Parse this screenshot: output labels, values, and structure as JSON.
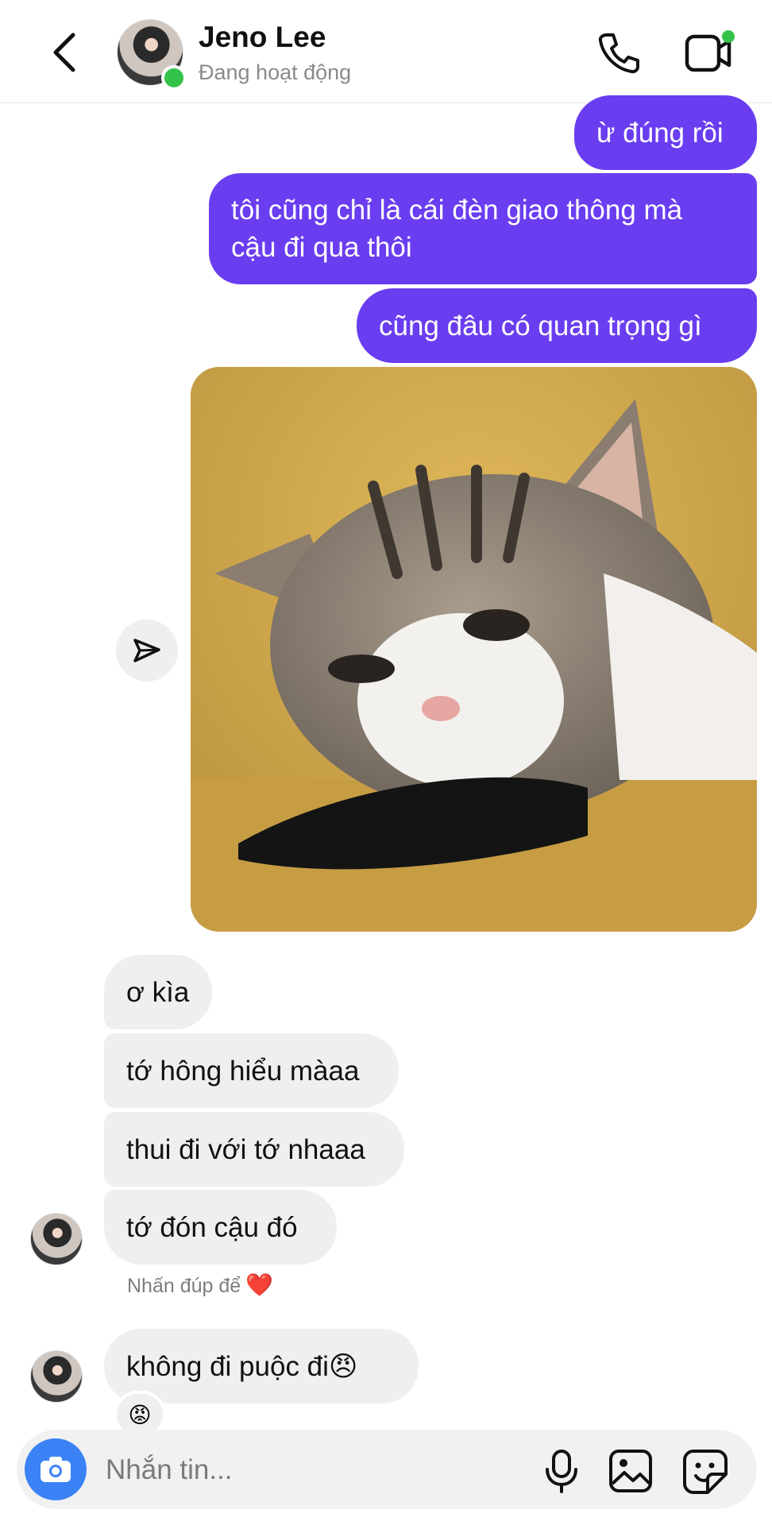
{
  "header": {
    "name": "Jeno Lee",
    "status": "Đang hoạt động"
  },
  "messages": {
    "outgoing": [
      "ừ đúng rồi",
      "tôi cũng chỉ là cái đèn giao thông mà cậu đi qua thôi",
      "cũng đâu có quan trọng gì"
    ],
    "incoming": [
      "ơ kìa",
      "tớ hông hiểu màaa",
      "thui đi với tớ nhaaa",
      "tớ đón cậu đó",
      "không đi puộc đi😠"
    ],
    "hint": "Nhấn đúp để",
    "hint_emoji": "❤️",
    "reaction": "😡"
  },
  "composer": {
    "placeholder": "Nhắn tin..."
  },
  "colors": {
    "outgoing_bubble": "#6a3df0",
    "incoming_bubble": "#efefef",
    "online": "#35c24a",
    "camera": "#3b82f6"
  },
  "icons": [
    "back-arrow-icon",
    "phone-icon",
    "video-call-icon",
    "send-icon",
    "camera-icon",
    "microphone-icon",
    "gallery-icon",
    "sticker-icon"
  ]
}
